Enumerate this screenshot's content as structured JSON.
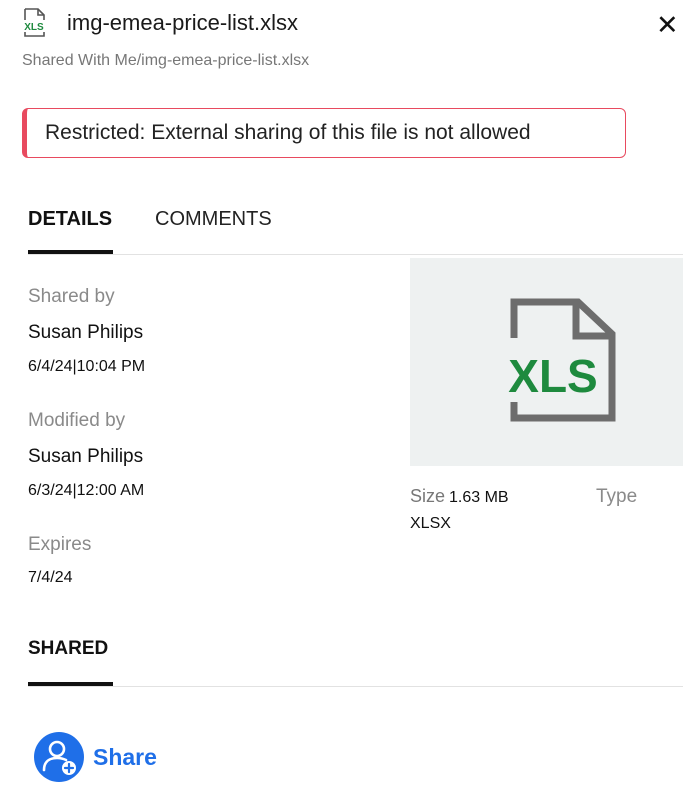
{
  "header": {
    "file_icon": "xls-file-icon",
    "file_icon_text": "XLS",
    "title": "img-emea-price-list.xlsx",
    "close_label": "✕",
    "breadcrumb": "Shared With Me/img-emea-price-list.xlsx"
  },
  "alert": {
    "text": "Restricted: External sharing of this file is not allowed",
    "border_color": "#e84a5f"
  },
  "tabs": [
    {
      "label": "DETAILS",
      "active": true
    },
    {
      "label": "COMMENTS",
      "active": false
    }
  ],
  "details": {
    "shared_by_label": "Shared by",
    "shared_by_name": "Susan Philips",
    "shared_by_date": "6/4/24|10:04 PM",
    "modified_by_label": "Modified by",
    "modified_by_name": "Susan Philips",
    "modified_by_date": "6/3/24|12:00 AM",
    "expires_label": "Expires",
    "expires_date": "7/4/24",
    "size_label": "Size",
    "size_value": "1.63 MB",
    "type_label": "Type",
    "type_value": "XLSX"
  },
  "preview": {
    "icon": "xls-document-icon",
    "text": "XLS",
    "text_color": "#1e8a3e",
    "outline_color": "#6d6d6d"
  },
  "shared": {
    "heading": "SHARED",
    "share_label": "Share",
    "share_icon": "add-user-icon",
    "accent": "#1f6fe8"
  }
}
